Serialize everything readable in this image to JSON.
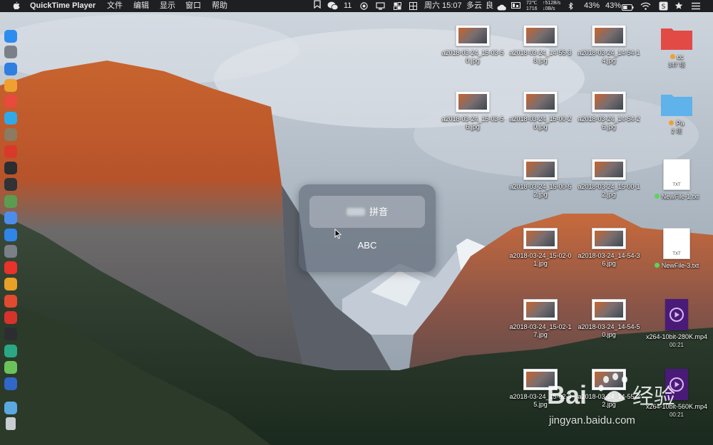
{
  "menubar": {
    "app_name": "QuickTime Player",
    "menus": [
      "文件",
      "编辑",
      "显示",
      "窗口",
      "帮助"
    ],
    "wechat_count": "11",
    "datetime": "周六 15:07",
    "weather": "多云",
    "air_quality": "良",
    "cpu_temp": "72℃",
    "fan_rpm": "1716",
    "net_up": "↑512B/s",
    "net_down": "↓0B/s",
    "battery1": "43%",
    "battery2": "43%"
  },
  "dock": {
    "icons": [
      "finder-icon",
      "launchpad-icon",
      "safari-icon",
      "contacts-icon",
      "calendar-icon",
      "photos-icon",
      "disk-icon",
      "app-icon",
      "activity-monitor-icon",
      "terminal-icon",
      "preview-icon",
      "siri-icon",
      "app-store-icon",
      "system-preferences-icon",
      "yandex-icon",
      "chrome-icon",
      "weibo-icon",
      "vivaldi-icon",
      "console-icon",
      "sync-icon",
      "wechat-icon",
      "browser-icon",
      "downloads-folder-icon",
      "trash-icon"
    ]
  },
  "desktop_files": [
    {
      "name": "a2018-03-24_15-03-50.jpg",
      "type": "image"
    },
    {
      "name": "a2018-03-24_14-55-38.jpg",
      "type": "image"
    },
    {
      "name": "a2018-03-24_14-54-14.jpg",
      "type": "image"
    },
    {
      "name": "cc",
      "sub": "347 项",
      "type": "folder-red"
    },
    {
      "name": "a2018-03-24_15-03-56.jpg",
      "type": "image"
    },
    {
      "name": "a2018-03-24_15-00-20.jpg",
      "type": "image"
    },
    {
      "name": "a2018-03-24_14-54-26.jpg",
      "type": "image"
    },
    {
      "name": "Pa",
      "sub": "2 项",
      "type": "folder-blue"
    },
    {
      "name": "a2018-03-24_15-00-52.jpg",
      "type": "image"
    },
    {
      "name": "a2018-03-24_15-00-12.jpg",
      "type": "image"
    },
    {
      "name": "NewFile-1.txt",
      "type": "txt"
    },
    {
      "name": "a2018-03-24_15-02-01.jpg",
      "type": "image"
    },
    {
      "name": "a2018-03-24_14-54-36.jpg",
      "type": "image"
    },
    {
      "name": "NewFile-3.txt",
      "type": "txt"
    },
    {
      "name": "a2018-03-24_15-02-17.jpg",
      "type": "image"
    },
    {
      "name": "a2018-03-24_14-54-50.jpg",
      "type": "image"
    },
    {
      "name": "x264-10bit-280K.mp4",
      "sub": "00:21",
      "type": "video"
    },
    {
      "name": "a2018-03-24_15-02-35.jpg",
      "type": "image"
    },
    {
      "name": "a2018-03-24_14-55-22.jpg",
      "type": "image"
    },
    {
      "name": "x264-10bit-560K.mp4",
      "sub": "00:21",
      "type": "video"
    }
  ],
  "txt_ext": "TXT",
  "input_switcher": {
    "options": [
      {
        "label": "拼音",
        "selected": true
      },
      {
        "label": "ABC",
        "selected": false
      }
    ]
  },
  "watermark": {
    "brand": "Bai 经验",
    "url": "jingyan.baidu.com"
  },
  "colors": {
    "menubar_bg": "#1d1f22",
    "folder_red": "#e24a46",
    "folder_blue": "#5fb2ea",
    "tag_orange": "#f0a030",
    "tag_green": "#5bd45b",
    "video_purple": "#4a1a78"
  }
}
